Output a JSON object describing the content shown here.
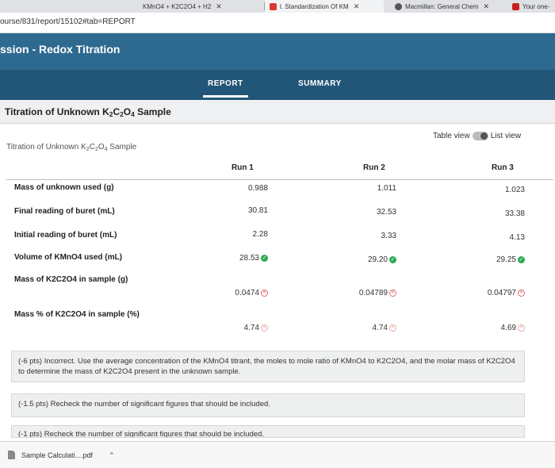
{
  "browser": {
    "tabs": [
      {
        "label": "KMnO4 + K2C2O4 + H2",
        "active": false
      },
      {
        "label": "l. Standardization Of KM",
        "active": true
      },
      {
        "label": "Macmillan: General Chem",
        "active": false
      },
      {
        "label": "Your one-",
        "active": false
      }
    ],
    "url": "ourse/831/report/15102#tab=REPORT"
  },
  "header": {
    "title": "ssion - Redox Titration",
    "tabs": [
      "REPORT",
      "SUMMARY"
    ],
    "active_tab": "REPORT"
  },
  "section": {
    "title_pre": "Titration of Unknown K",
    "title_sub1": "2",
    "title_mid": "C",
    "title_sub2": "2",
    "title_o": "O",
    "title_sub3": "4",
    "title_post": " Sample"
  },
  "view": {
    "table_view": "Table view",
    "list_view": "List view"
  },
  "table": {
    "caption_pre": "Titration of Unknown K",
    "caption_post": " Sample",
    "columns": [
      "Run 1",
      "Run 2",
      "Run 3"
    ],
    "rows": [
      {
        "label": "Mass of unknown used (g)",
        "values": [
          "0.988",
          "1.011",
          "1.023"
        ],
        "status": "none"
      },
      {
        "label": "Final reading of buret (mL)",
        "values": [
          "30.81",
          "32.53",
          "33.38"
        ],
        "status": "none"
      },
      {
        "label": "Initial reading of buret (mL)",
        "values": [
          "2.28",
          "3.33",
          "4.13"
        ],
        "status": "none"
      },
      {
        "label": "Volume of KMnO4 used (mL)",
        "values": [
          "28.53",
          "29.20",
          "29.25"
        ],
        "status": "correct"
      },
      {
        "label": "Mass of K2C2O4 in sample (g)",
        "values": [
          "0.0474",
          "0.04789",
          "0.04797"
        ],
        "status": "incorrect"
      },
      {
        "label": "Mass % of K2C2O4 in sample (%)",
        "values": [
          "4.74",
          "4.74",
          "4.69"
        ],
        "status": "incorrect"
      }
    ]
  },
  "feedback": [
    "(-6 pts) Incorrect. Use the average concentration of the KMnO4 titrant, the moles to mole ratio of KMnO4 to K2C2O4, and the molar mass of K2C2O4 to determine the mass of K2C2O4 present in the unknown sample.",
    "(-1.5 pts) Recheck the number of significant figures that should be included.",
    "(-1 pts) Recheck the number of significant figures that should be included."
  ],
  "downloads": {
    "file": "Sample Calculati....pdf"
  },
  "colors": {
    "header": "#2e6a8f",
    "header_tabs": "#225678",
    "correct": "#2eaa52",
    "incorrect": "#e06767"
  },
  "icons": [
    "close-icon",
    "gmail-icon",
    "checkmark-icon",
    "x-circle-icon",
    "toggle-icon",
    "file-icon",
    "chevron-up-icon"
  ]
}
